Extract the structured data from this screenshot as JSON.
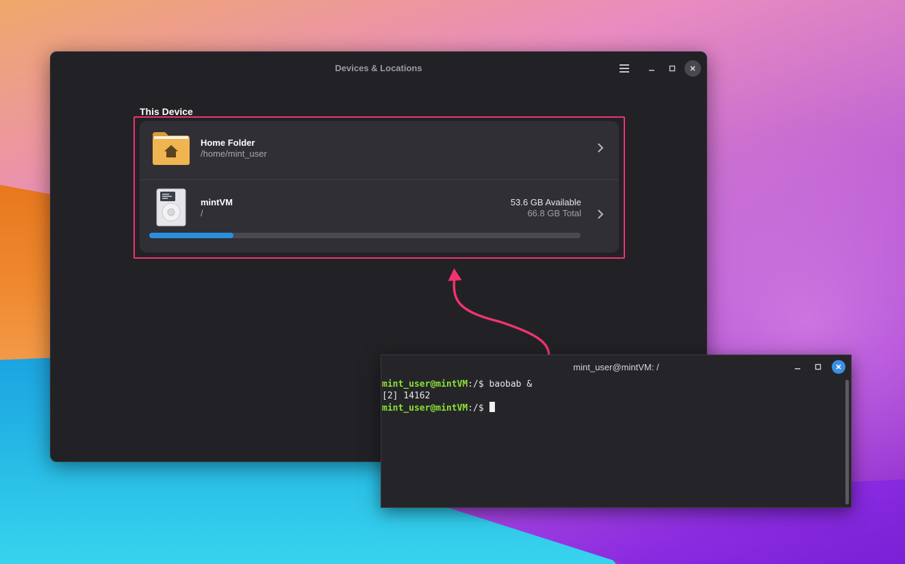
{
  "main_window": {
    "title": "Devices & Locations",
    "section_label": "This Device",
    "items": [
      {
        "name": "Home Folder",
        "path": "/home/mint_user",
        "icon": "home-folder-icon"
      },
      {
        "name": "mintVM",
        "path": "/",
        "icon": "hard-drive-icon",
        "available": "53.6 GB Available",
        "total": "66.8 GB Total",
        "usage_fraction": 0.195
      }
    ]
  },
  "terminal": {
    "title": "mint_user@mintVM: /",
    "lines": [
      {
        "user": "mint_user@mintVM",
        "path": ":/",
        "prompt": "$ ",
        "command": "baobab &"
      },
      {
        "output": "[2] 14162"
      },
      {
        "user": "mint_user@mintVM",
        "path": ":/",
        "prompt": "$ ",
        "command": ""
      }
    ]
  },
  "colors": {
    "highlight": "#f2336f",
    "progress": "#2b8fe0",
    "prompt_user": "#8ae234",
    "folder": "#f0b450"
  }
}
